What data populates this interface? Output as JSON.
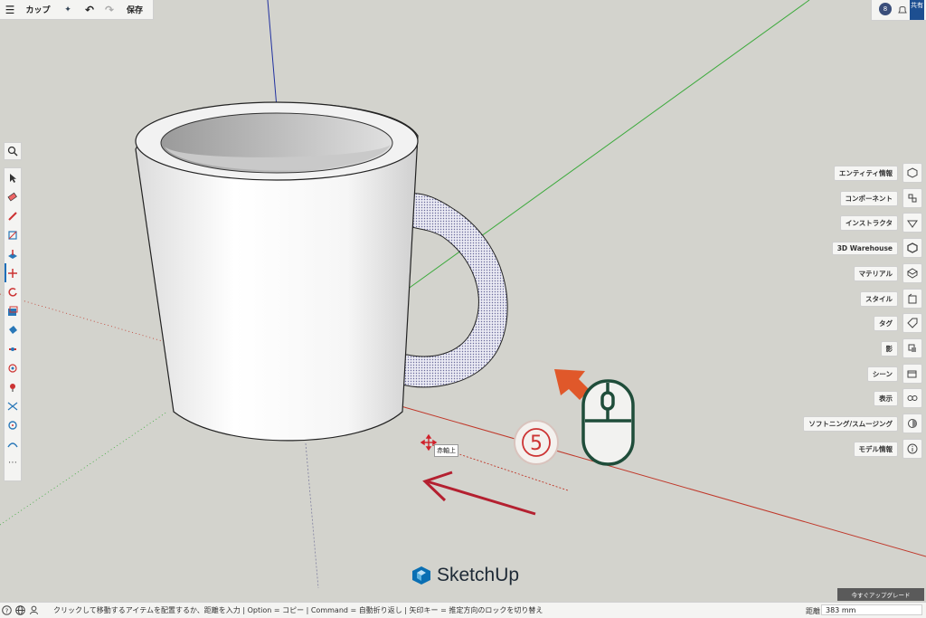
{
  "toolbar": {
    "menu_icon": "hamburger-icon",
    "title": "カップ",
    "save_label": "保存"
  },
  "account": {
    "avatar_initial": "8",
    "share_label": "共有"
  },
  "right_panel": {
    "items": [
      {
        "label": "エンティティ情報",
        "icon": "entity-info-icon"
      },
      {
        "label": "コンポーネント",
        "icon": "components-icon"
      },
      {
        "label": "インストラクタ",
        "icon": "instructor-icon"
      },
      {
        "label": "3D Warehouse",
        "icon": "warehouse-icon"
      },
      {
        "label": "マテリアル",
        "icon": "materials-icon"
      },
      {
        "label": "スタイル",
        "icon": "styles-icon"
      },
      {
        "label": "タグ",
        "icon": "tags-icon"
      },
      {
        "label": "影",
        "icon": "shadows-icon"
      },
      {
        "label": "シーン",
        "icon": "scenes-icon"
      },
      {
        "label": "表示",
        "icon": "display-icon"
      },
      {
        "label": "ソフトニング/スムージング",
        "icon": "soften-icon"
      },
      {
        "label": "モデル情報",
        "icon": "model-info-icon"
      }
    ]
  },
  "viewport": {
    "tooltip": "赤軸上",
    "step_number": "5",
    "brand": "SketchUp",
    "colors": {
      "red_axis": "#c0392b",
      "green_axis": "#3caa3c",
      "blue_axis": "#2030a0",
      "accent": "#e0582a",
      "mouse": "#1f4d3a"
    }
  },
  "upgrade_label": "今すぐアップグレード",
  "status": {
    "hint": "クリックして移動するアイテムを配置するか、距離を入力 | Option = コピー | Command = 自動折り返し | 矢印キー = 推定方向のロックを切り替え",
    "distance_label": "距離",
    "distance_value": "383 mm"
  }
}
